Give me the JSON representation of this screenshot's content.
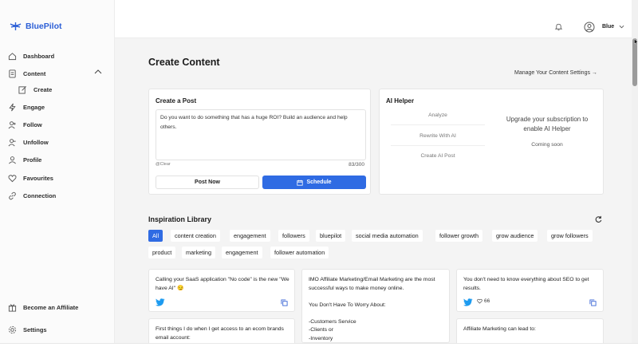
{
  "brand": {
    "name": "BluePilot",
    "accent": "#2f6be3"
  },
  "sidebar": {
    "items": [
      {
        "label": "Dashboard",
        "icon": "home-icon"
      },
      {
        "label": "Content",
        "icon": "document-icon"
      },
      {
        "label": "Create",
        "icon": "edit-icon"
      },
      {
        "label": "Engage",
        "icon": "bolt-icon"
      },
      {
        "label": "Follow",
        "icon": "user-plus-icon"
      },
      {
        "label": "Unfollow",
        "icon": "user-minus-icon"
      },
      {
        "label": "Profile",
        "icon": "user-icon"
      },
      {
        "label": "Favourites",
        "icon": "heart-icon"
      },
      {
        "label": "Connection",
        "icon": "link-icon"
      }
    ],
    "bottom": [
      {
        "label": "Become an Affiliate",
        "icon": "gift-icon"
      },
      {
        "label": "Settings",
        "icon": "gear-icon"
      }
    ]
  },
  "topbar": {
    "user_name": "Blue"
  },
  "page": {
    "title": "Create Content",
    "settings_link": "Manage Your Content Settings →"
  },
  "post": {
    "title": "Create a Post",
    "text": "Do you want to do something that has a huge ROI? Build an audience and help others.",
    "clear": "@Clear",
    "count": "83/300",
    "post_now": "Post Now",
    "schedule": "Schedule"
  },
  "ai": {
    "title": "AI Helper",
    "options": [
      "Analyze",
      "Rewrite With AI",
      "Create AI Post"
    ],
    "upgrade": "Upgrade your subscription to enable AI Helper",
    "coming": "Coming soon"
  },
  "inspiration": {
    "title": "Inspiration Library",
    "chips": [
      "All",
      "content creation",
      "engagement",
      "followers",
      "bluepilot",
      "social media automation",
      "follower growth",
      "grow audience",
      "grow followers",
      "product",
      "marketing",
      "engagement",
      "follower automation"
    ],
    "cards": [
      {
        "text": "Calling your SaaS application \"No code\" is the new \"We have AI\" 😏"
      },
      {
        "text": "IMO Affiliate Marketing/Email Marketing are the most successful ways to make money online.\n\nYou Don't Have To Worry About:\n\n-Customers Service\n-Clients or\n-Inventory"
      },
      {
        "text": "You don't need to know everything about SEO to get results.",
        "likes": "66"
      },
      {
        "text": "First things I do when I get access to an ecom brands email account:"
      },
      {
        "text": "Affiliate Marketing can lead to:"
      }
    ]
  }
}
